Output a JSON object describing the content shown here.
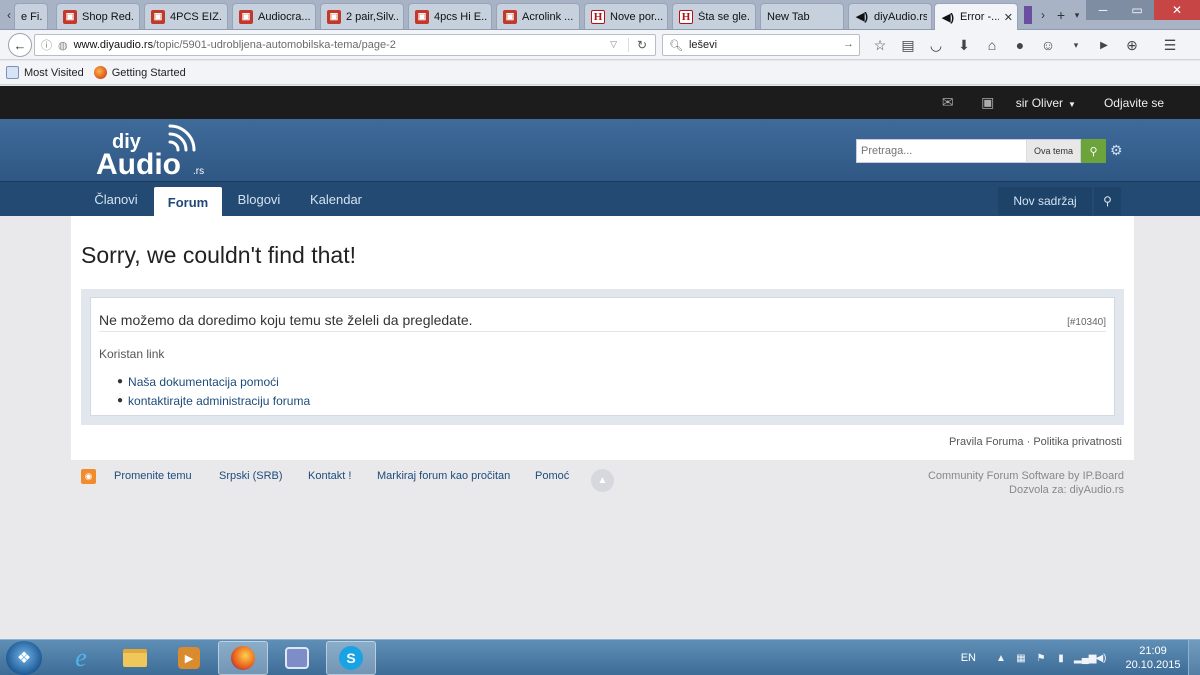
{
  "browser": {
    "tabs": [
      {
        "label": "e Fi...",
        "icon": "page-icon",
        "x": 0
      },
      {
        "label": "Shop Red...",
        "icon": "cart-icon"
      },
      {
        "label": "4PCS EIZ...",
        "icon": "cart-icon"
      },
      {
        "label": "Audiocra...",
        "icon": "cart-icon"
      },
      {
        "label": "2 pair,Silv...",
        "icon": "cart-icon"
      },
      {
        "label": "4pcs Hi E...",
        "icon": "cart-icon"
      },
      {
        "label": "Acrolink ...",
        "icon": "cart-icon"
      },
      {
        "label": "Nove por...",
        "icon": "h-icon"
      },
      {
        "label": "Šta se gle...",
        "icon": "h-icon"
      },
      {
        "label": "New Tab",
        "icon": ""
      },
      {
        "label": "diyAudio.rs",
        "icon": "speaker-icon"
      },
      {
        "label": "Error -...",
        "icon": "speaker-icon",
        "active": true
      }
    ],
    "url": {
      "domain": "www.diyaudio.rs",
      "path": "/topic/5901-udrobljena-automobilska-tema/page-2"
    },
    "search_query": "leševi",
    "bookmarks": [
      "Most Visited",
      "Getting Started"
    ]
  },
  "site": {
    "user_name": "sir Oliver",
    "logout_label": "Odjavite se",
    "logo_text": {
      "top": "diy",
      "main": "Audio",
      "suffix": ".rs"
    },
    "search": {
      "placeholder": "Pretraga...",
      "scope": "Ova tema"
    },
    "nav": [
      {
        "label": "Članovi",
        "active": false
      },
      {
        "label": "Forum",
        "active": true
      },
      {
        "label": "Blogovi",
        "active": false
      },
      {
        "label": "Kalendar",
        "active": false
      }
    ],
    "nav_new_content": "Nov sadržaj"
  },
  "error": {
    "title": "Sorry, we couldn't find that!",
    "message": "Ne možemo da doredimo koju temu ste želeli da pregledate.",
    "code": "[#10340]",
    "useful_link_label": "Koristan link",
    "links": [
      "Naša dokumentacija pomoći",
      "kontaktirajte administraciju foruma"
    ]
  },
  "content_footer": {
    "rules": "Pravila Foruma",
    "separator": "·",
    "privacy": "Politika privatnosti"
  },
  "footer": {
    "links": [
      "Promenite temu",
      "Srpski (SRB)",
      "Kontakt !",
      "Markiraj forum kao pročitan",
      "Pomoć"
    ],
    "powered_by": "Community Forum Software by IP.Board",
    "licensed_to": "Dozvola za: diyAudio.rs"
  },
  "taskbar": {
    "language": "EN",
    "time": "21:09",
    "date": "20.10.2015"
  },
  "colors": {
    "header_blue": "#3f6b9a",
    "nav_blue": "#234a72",
    "link_blue": "#1e4b7a",
    "search_green": "#6ca33a"
  }
}
